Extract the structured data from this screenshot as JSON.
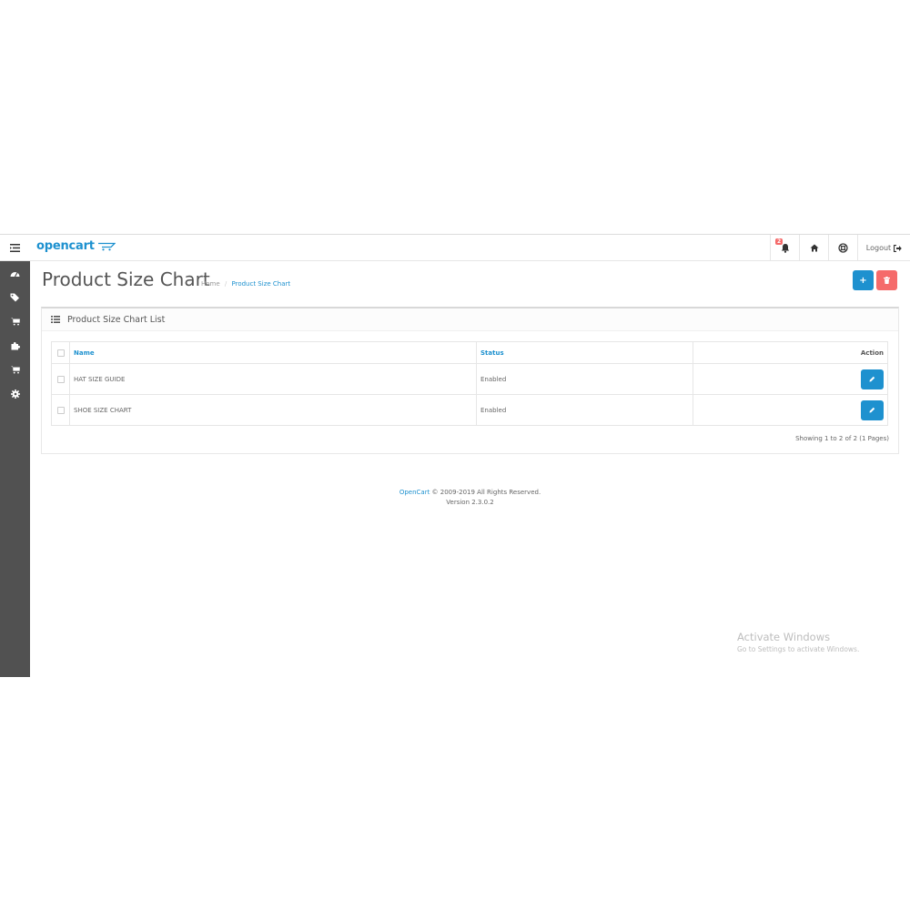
{
  "header": {
    "logo_text": "opencart",
    "notification_count": "2",
    "logout_label": "Logout",
    "icons": [
      "menu-toggle-icon",
      "bell-icon",
      "home-icon",
      "life-ring-icon",
      "sign-out-icon"
    ]
  },
  "sidebar": {
    "items": [
      {
        "icon": "dashboard-icon"
      },
      {
        "icon": "tags-icon"
      },
      {
        "icon": "shopping-cart-icon"
      },
      {
        "icon": "puzzle-icon"
      },
      {
        "icon": "shopping-cart-icon"
      },
      {
        "icon": "gear-icon"
      }
    ]
  },
  "page": {
    "title": "Product Size Chart",
    "breadcrumb": {
      "home": "Home",
      "separator": "/",
      "current": "Product Size Chart"
    },
    "add_button": "+",
    "delete_icon": "trash-icon"
  },
  "panel": {
    "title": "Product Size Chart List",
    "columns": {
      "name": "Name",
      "status": "Status",
      "action": "Action"
    },
    "rows": [
      {
        "name": "HAT SIZE GUIDE",
        "status": "Enabled"
      },
      {
        "name": "SHOE SIZE CHART",
        "status": "Enabled"
      }
    ],
    "pagination": "Showing 1 to 2 of 2 (1 Pages)"
  },
  "footer": {
    "brand": "OpenCart",
    "copyright": " © 2009-2019 All Rights Reserved.",
    "version": "Version 2.3.0.2"
  },
  "watermark": {
    "line1": "Activate Windows",
    "line2": "Go to Settings to activate Windows."
  },
  "colors": {
    "accent": "#1e91cf",
    "danger": "#f56b6b",
    "sidebar": "#515151"
  }
}
